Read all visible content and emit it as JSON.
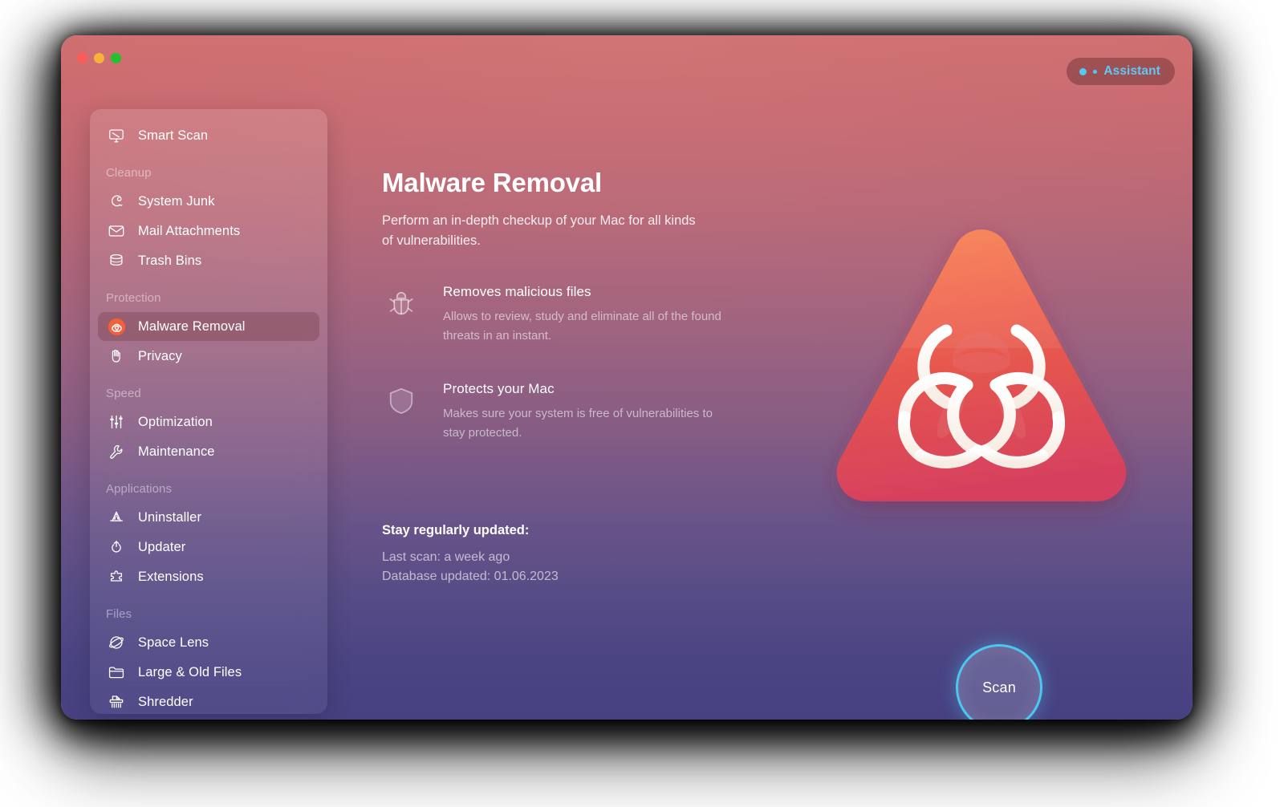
{
  "app": {
    "accent_cyan": "#4cc7f0",
    "window_gradient_top": "#cf6d6e",
    "window_gradient_bottom": "#474182"
  },
  "titlebar": {
    "traffic_lights": [
      {
        "name": "close",
        "color": "#fc5b56"
      },
      {
        "name": "minimize",
        "color": "#f8b13a"
      },
      {
        "name": "maximize",
        "color": "#22c12f"
      }
    ],
    "assistant": {
      "label": "Assistant",
      "icon": "two-dots-icon",
      "color": "#5fc9f3"
    }
  },
  "sidebar": {
    "top_item": {
      "label": "Smart Scan",
      "icon": "display-scan-icon"
    },
    "groups": [
      {
        "label": "Cleanup",
        "items": [
          {
            "label": "System Junk",
            "icon": "broom-icon"
          },
          {
            "label": "Mail Attachments",
            "icon": "envelope-icon"
          },
          {
            "label": "Trash Bins",
            "icon": "trash-bin-icon"
          }
        ]
      },
      {
        "label": "Protection",
        "items": [
          {
            "label": "Malware Removal",
            "icon": "biohazard-icon",
            "selected": true
          },
          {
            "label": "Privacy",
            "icon": "hand-stop-icon"
          }
        ]
      },
      {
        "label": "Speed",
        "items": [
          {
            "label": "Optimization",
            "icon": "sliders-icon"
          },
          {
            "label": "Maintenance",
            "icon": "wrench-icon"
          }
        ]
      },
      {
        "label": "Applications",
        "items": [
          {
            "label": "Uninstaller",
            "icon": "uninstaller-icon"
          },
          {
            "label": "Updater",
            "icon": "refresh-arrow-icon"
          },
          {
            "label": "Extensions",
            "icon": "puzzle-piece-icon"
          }
        ]
      },
      {
        "label": "Files",
        "items": [
          {
            "label": "Space Lens",
            "icon": "space-lens-icon"
          },
          {
            "label": "Large & Old Files",
            "icon": "folder-icon"
          },
          {
            "label": "Shredder",
            "icon": "shredder-icon"
          }
        ]
      }
    ]
  },
  "main": {
    "title": "Malware Removal",
    "subtitle": "Perform an in-depth checkup of your Mac for all kinds of vulnerabilities.",
    "features": [
      {
        "icon": "bug-icon",
        "title": "Removes malicious files",
        "desc": "Allows to review, study and eliminate all of the found threats in an instant."
      },
      {
        "icon": "shield-icon",
        "title": "Protects your Mac",
        "desc": "Makes sure your system is free of vulnerabilities to stay protected."
      }
    ],
    "status": {
      "heading": "Stay regularly updated:",
      "lines": [
        "Last scan: a week ago",
        "Database updated: 01.06.2023"
      ]
    },
    "hero_icon": "biohazard-triangle-illustration",
    "scan_button": {
      "label": "Scan"
    }
  }
}
